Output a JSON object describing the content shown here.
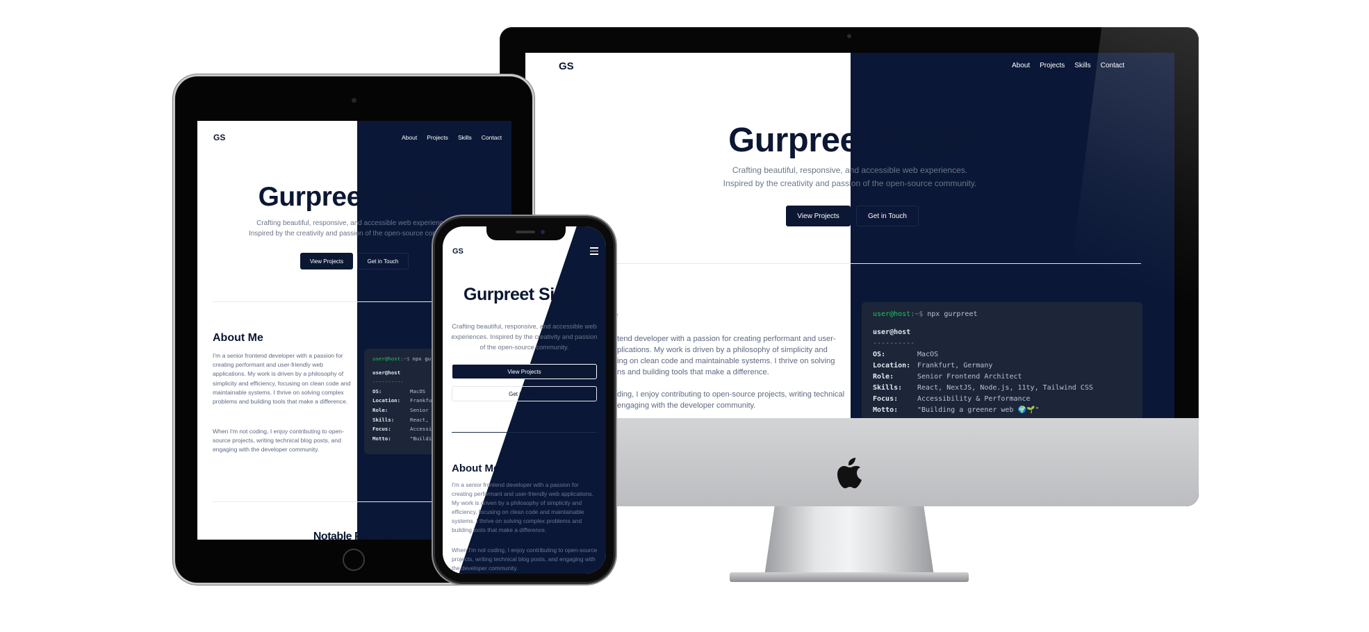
{
  "site": {
    "logo": "GS",
    "nav": [
      "About",
      "Projects",
      "Skills",
      "Contact"
    ],
    "hero_title": "Gurpreet Singh",
    "hero_line1": "Crafting beautiful, responsive, and accessible web experiences.",
    "hero_line2": "Inspired by the creativity and passion of the open-source community.",
    "hero_mobile": "Crafting beautiful, responsive, and accessible web experiences. Inspired by the creativity and passion of the open-source community.",
    "btn_projects": "View Projects",
    "btn_contact": "Get in Touch",
    "about_title": "About Me",
    "about_p1": "I'm a senior frontend developer with a passion for creating performant and user-friendly web applications. My work is driven by a philosophy of simplicity and efficiency, focusing on clean code and maintainable systems. I thrive on solving complex problems and building tools that make a difference.",
    "about_p2": "When I'm not coding, I enjoy contributing to open-source projects, writing technical blog posts, and engaging with the developer community.",
    "projects_title": "Notable Projects",
    "imac_about_frag": "e",
    "imac_p1_lines": [
      "tend developer with a passion for creating performant and user-",
      "plications. My work is driven by a philosophy of simplicity and",
      "ing on clean code and maintainable systems. I thrive on solving",
      "ns and building tools that make a difference."
    ],
    "imac_p2_lines": [
      "ding, I enjoy contributing to open-source projects, writing technical",
      "engaging with the developer community."
    ]
  },
  "terminal": {
    "prompt_user": "user@host",
    "prompt_path": ":~$",
    "command": "npx gurpreet",
    "header": "user@host",
    "separator": "----------",
    "rows": [
      {
        "key": "OS:",
        "val": "MacOS"
      },
      {
        "key": "Location:",
        "val": "Frankfurt, Germany"
      },
      {
        "key": "Role:",
        "val": "Senior Frontend Architect"
      },
      {
        "key": "Skills:",
        "val": "React, NextJS, Node.js, 11ty, Tailwind CSS"
      },
      {
        "key": "Focus:",
        "val": "Accessibility & Performance"
      },
      {
        "key": "Motto:",
        "val": "\"Building a greener web 🌍🌱\""
      }
    ],
    "ipad_command": "npx gu",
    "ipad_rows": [
      {
        "key": "OS:",
        "val": "MacOS"
      },
      {
        "key": "Location:",
        "val": "Frankfur"
      },
      {
        "key": "Role:",
        "val": "Senior F"
      },
      {
        "key": "Skills:",
        "val": "React, N"
      },
      {
        "key": "Focus:",
        "val": "Accessib"
      },
      {
        "key": "Motto:",
        "val": "\"Buildin"
      }
    ]
  },
  "colors": {
    "navy": "#0a1736",
    "prompt": "#22c55e",
    "terminal_bg": "#1c2638"
  },
  "icons": {
    "menu": "hamburger-menu-icon",
    "brand": "apple-logo-icon"
  }
}
